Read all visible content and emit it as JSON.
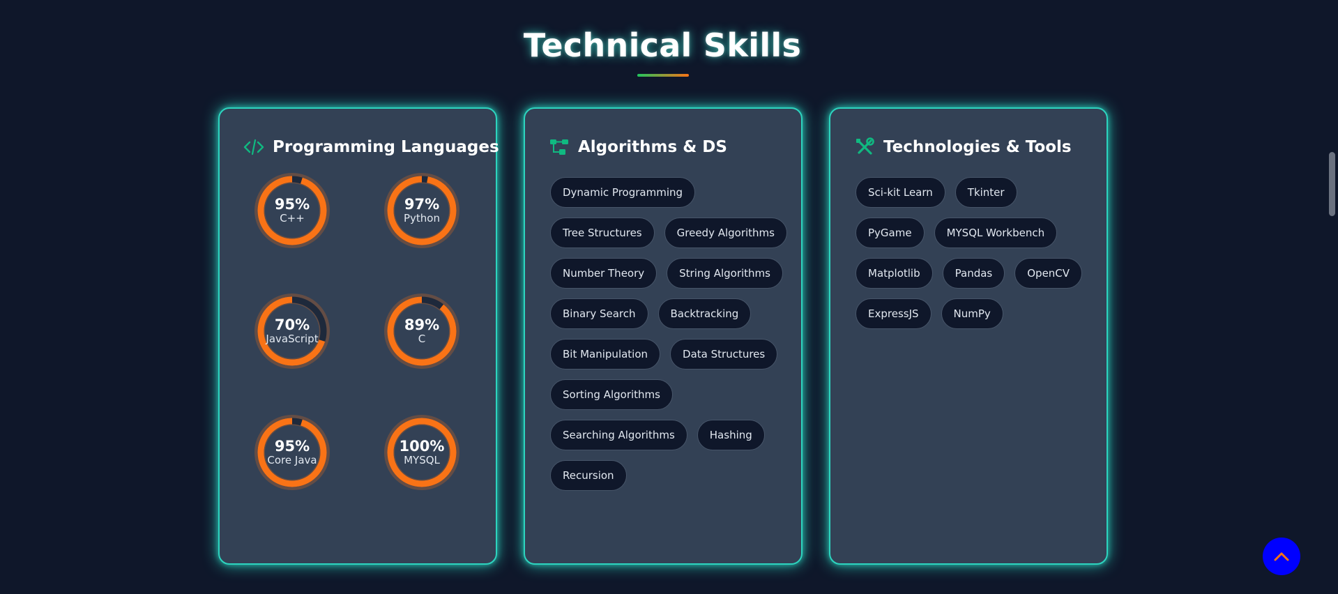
{
  "section": {
    "title": "Technical Skills",
    "underline_colors": [
      "#22c55e",
      "#f97316"
    ]
  },
  "colors": {
    "accent": "#2dd4bf",
    "progress": "#f97316",
    "track": "#1e293b",
    "card_bg": "#334155",
    "page_bg": "#0f172a",
    "icon": "#10b981",
    "scroll_button_bg": "#0000ff",
    "scroll_button_icon": "#f97316"
  },
  "cards": {
    "languages": {
      "title": "Programming Languages",
      "icon": "code-icon",
      "skills": [
        {
          "percent_label": "95%",
          "name": "C++",
          "value": 95
        },
        {
          "percent_label": "97%",
          "name": "Python",
          "value": 97
        },
        {
          "percent_label": "70%",
          "name": "JavaScript",
          "value": 70
        },
        {
          "percent_label": "89%",
          "name": "C",
          "value": 89
        },
        {
          "percent_label": "95%",
          "name": "Core Java",
          "value": 95
        },
        {
          "percent_label": "100%",
          "name": "MYSQL",
          "value": 100
        }
      ]
    },
    "algorithms": {
      "title": "Algorithms & DS",
      "icon": "network-icon",
      "tags": [
        "Dynamic Programming",
        "Tree Structures",
        "Greedy Algorithms",
        "Number Theory",
        "String Algorithms",
        "Binary Search",
        "Backtracking",
        "Bit Manipulation",
        "Data Structures",
        "Sorting Algorithms",
        "Searching Algorithms",
        "Hashing",
        "Recursion"
      ]
    },
    "tools": {
      "title": "Technologies & Tools",
      "icon": "tools-icon",
      "tags": [
        "Sci-kit Learn",
        "Tkinter",
        "PyGame",
        "MYSQL Workbench",
        "Matplotlib",
        "Pandas",
        "OpenCV",
        "ExpressJS",
        "NumPy"
      ]
    }
  },
  "scroll_button": {
    "icon": "chevron-up-icon"
  }
}
